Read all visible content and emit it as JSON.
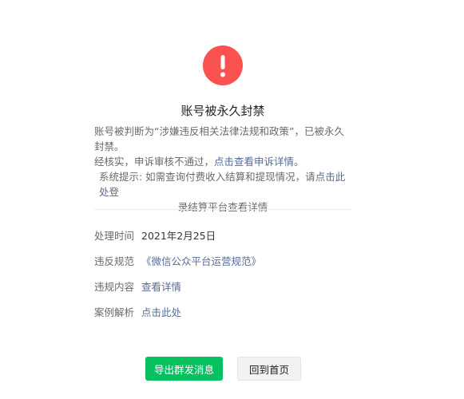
{
  "colors": {
    "warning": "#fa5151",
    "primary": "#07c160",
    "link": "#576b95"
  },
  "header": {
    "icon": "exclamation-icon",
    "title": "账号被永久封禁"
  },
  "description": {
    "line1": "账号被判断为“涉嫌违反相关法律法规和政策”，已被永久封禁。",
    "line2_prefix": "经核实，申诉审核不通过，",
    "line2_link": "点击查看申诉详情",
    "line2_suffix": "。",
    "line3_prefix": "系统提示: 如需查询付费收入结算和提现情况，请",
    "line3_link": "点击此处",
    "line3_suffix": "登",
    "line3b": "录结算平台查看详情"
  },
  "info": [
    {
      "label": "处理时间",
      "value": "2021年2月25日",
      "is_link": false
    },
    {
      "label": "违反规范",
      "value": "《微信公众平台运营规范》",
      "is_link": true
    },
    {
      "label": "违规内容",
      "value": "查看详情",
      "is_link": true
    },
    {
      "label": "案例解析",
      "value": "点击此处",
      "is_link": true
    }
  ],
  "buttons": {
    "export_label": "导出群发消息",
    "home_label": "回到首页"
  }
}
